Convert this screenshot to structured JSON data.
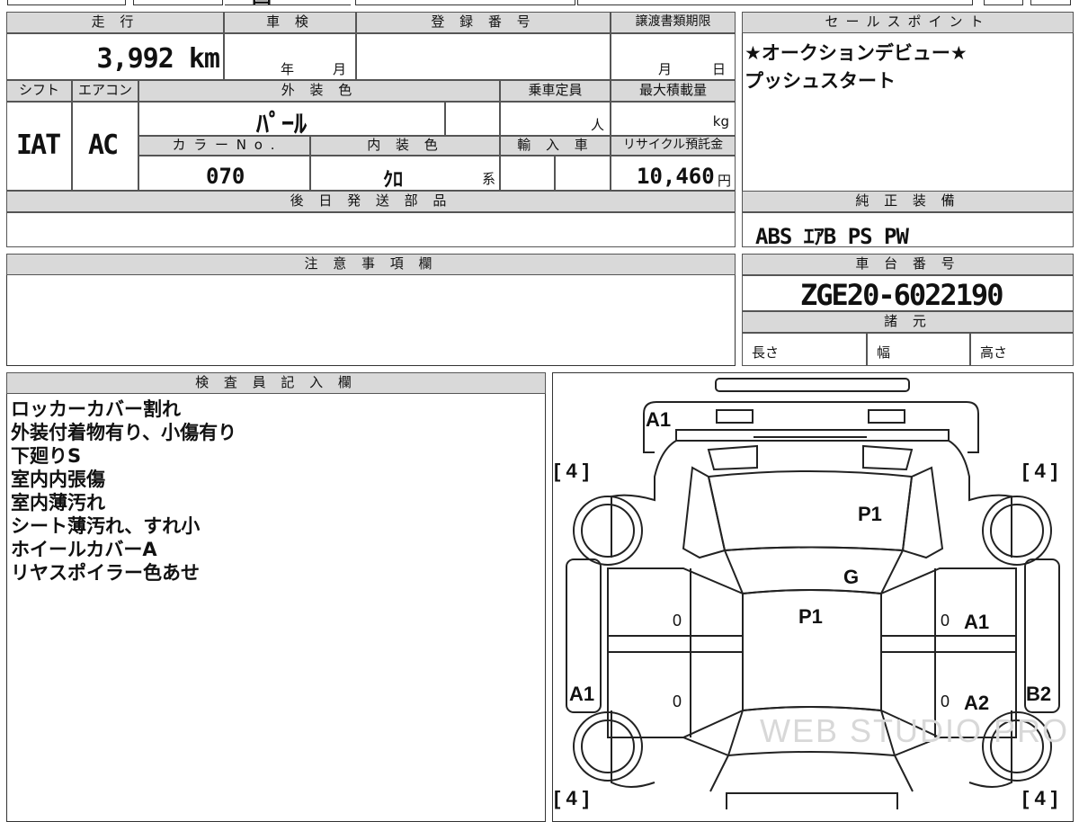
{
  "top_strip": {
    "partial_text": "国"
  },
  "basic": {
    "mileage_label": "走 行",
    "mileage_value": "3,992 km",
    "inspection_label": "車 検",
    "inspection_year_unit": "年",
    "inspection_month_unit": "月",
    "registration_label": "登 録 番 号",
    "transfer_deadline_label": "譲渡書類期限",
    "transfer_month_unit": "月",
    "transfer_day_unit": "日",
    "shift_label": "シフト",
    "shift_value": "IAT",
    "aircon_label": "エアコン",
    "aircon_value": "AC",
    "exterior_color_label": "外 装 色",
    "exterior_color_value": "ﾊﾟｰﾙ",
    "capacity_label": "乗車定員",
    "capacity_unit": "人",
    "max_load_label": "最大積載量",
    "max_load_unit": "kg",
    "color_no_label": "カ ラ ー N o .",
    "color_no_value": "070",
    "interior_color_label": "内 装 色",
    "interior_color_value": "ｸﾛ",
    "interior_color_suffix": "系",
    "import_label": "輸 入 車",
    "recycle_label": "リサイクル預託金",
    "recycle_value": "10,460",
    "recycle_unit": "円",
    "later_parts_label": "後 日 発 送 部 品"
  },
  "sales_points": {
    "label": "セールスポイント",
    "lines": [
      "★オークションデビュー★",
      "プッシュスタート"
    ]
  },
  "equipment": {
    "label": "純 正 装 備",
    "value": "ABS ｴｱB PS PW"
  },
  "caution": {
    "label": "注 意 事 項 欄"
  },
  "chassis": {
    "label": "車 台 番 号",
    "value": "ZGE20-6022190",
    "spec_label": "諸 元",
    "length_label": "長さ",
    "width_label": "幅",
    "height_label": "高さ"
  },
  "inspector": {
    "label": "検 査 員 記 入 欄",
    "notes": [
      "ロッカーカバー割れ",
      "外装付着物有り、小傷有り",
      "下廻りS",
      "室内内張傷",
      "室内薄汚れ",
      "シート薄汚れ、すれ小",
      "ホイールカバーA",
      "リヤスポイラー色あせ"
    ]
  },
  "diagram": {
    "tire_tl": "[ 4 ]",
    "tire_tr": "[ 4 ]",
    "tire_bl": "[ 4 ]",
    "tire_br": "[ 4 ]",
    "front_bumper": "A1",
    "hood": "P1",
    "windshield": "G",
    "roof": "P1",
    "left_rocker": "A1",
    "right_front_door": "A1",
    "right_rear_door": "A2",
    "right_rocker": "B2",
    "door_zero_lf": "0",
    "door_zero_lr": "0",
    "door_zero_rf": "0",
    "door_zero_rr": "0",
    "watermark": "WEB STUDIO PRO"
  }
}
